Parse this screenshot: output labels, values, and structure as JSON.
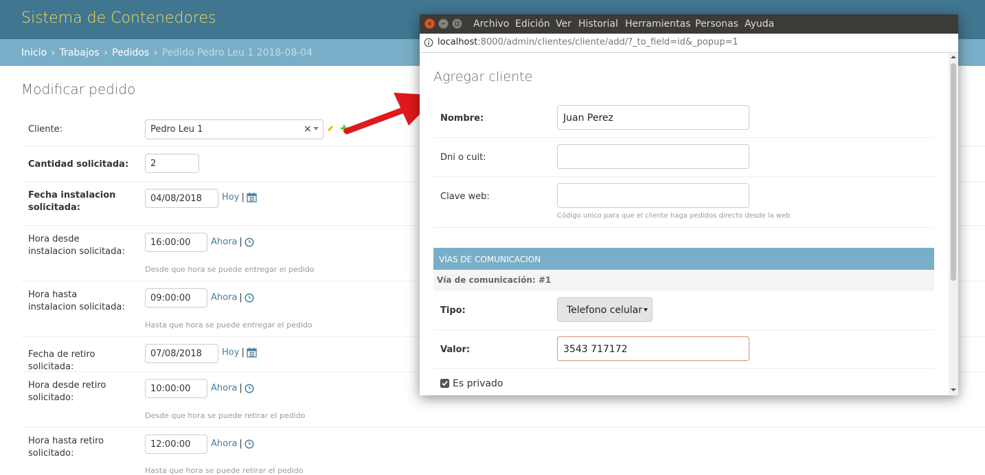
{
  "header": {
    "branding": "Sistema de Contenedores"
  },
  "breadcrumbs": {
    "inicio": "Inicio",
    "trabajos": "Trabajos",
    "pedidos": "Pedidos",
    "sep": "›",
    "current": "Pedido Pedro Leu 1 2018-08-04"
  },
  "page_title": "Modificar pedido",
  "form": {
    "cliente": {
      "label": "Cliente:",
      "value": "Pedro Leu 1",
      "clear": "×"
    },
    "cantidad": {
      "label": "Cantidad solicitada:",
      "value": "2"
    },
    "fecha_inst": {
      "label": "Fecha instalacion solicitada:",
      "value": "04/08/2018",
      "link": "Hoy"
    },
    "hora_desde_inst": {
      "label": "Hora desde instalacion solicitada:",
      "value": "16:00:00",
      "link": "Ahora",
      "help": "Desde que hora se puede entregar el pedido"
    },
    "hora_hasta_inst": {
      "label": "Hora hasta instalacion solicitada:",
      "value": "09:00:00",
      "link": "Ahora",
      "help": "Hasta que hora se puede entregar el pedido"
    },
    "fecha_retiro": {
      "label": "Fecha de retiro solicitada:",
      "value": "07/08/2018",
      "link": "Hoy"
    },
    "hora_desde_retiro": {
      "label": "Hora desde retiro solicitado:",
      "value": "10:00:00",
      "link": "Ahora",
      "help": "Desde que hora se puede retirar el pedido"
    },
    "hora_hasta_retiro": {
      "label": "Hora hasta retiro solicitado:",
      "value": "12:00:00",
      "link": "Ahora",
      "help": "Hasta que hora se puede retirar el pedido"
    },
    "bar": "|"
  },
  "popup": {
    "menu": [
      "Archivo",
      "Edición",
      "Ver",
      "Historial",
      "Herramientas",
      "Personas",
      "Ayuda"
    ],
    "url_host": "localhost",
    "url_rest": ":8000/admin/clientes/cliente/add/?_to_field=id&_popup=1",
    "title": "Agregar cliente",
    "nombre": {
      "label": "Nombre:",
      "value": "Juan Perez"
    },
    "dni": {
      "label": "Dni o cuit:",
      "value": ""
    },
    "clave": {
      "label": "Clave web:",
      "value": "",
      "help": "Código unico para que el cliente haga pedidos directo desde la web"
    },
    "section": "VÍAS DE COMUNICACION",
    "via": "Vía de comunicación: #1",
    "tipo": {
      "label": "Tipo:",
      "value": "Telefono celular"
    },
    "valor": {
      "label": "Valor:",
      "value": "3543 717172"
    },
    "privado": {
      "label": "Es privado",
      "checked": true
    }
  },
  "colors": {
    "header": "#417690",
    "breadcrumbs": "#79aec8",
    "branding": "#f5dd5d",
    "link": "#447e9b",
    "arrow": "#e0191b"
  },
  "icons": [
    "pencil-icon",
    "plus-icon",
    "calendar-icon",
    "clock-icon",
    "info-icon",
    "arrow-annotation"
  ]
}
